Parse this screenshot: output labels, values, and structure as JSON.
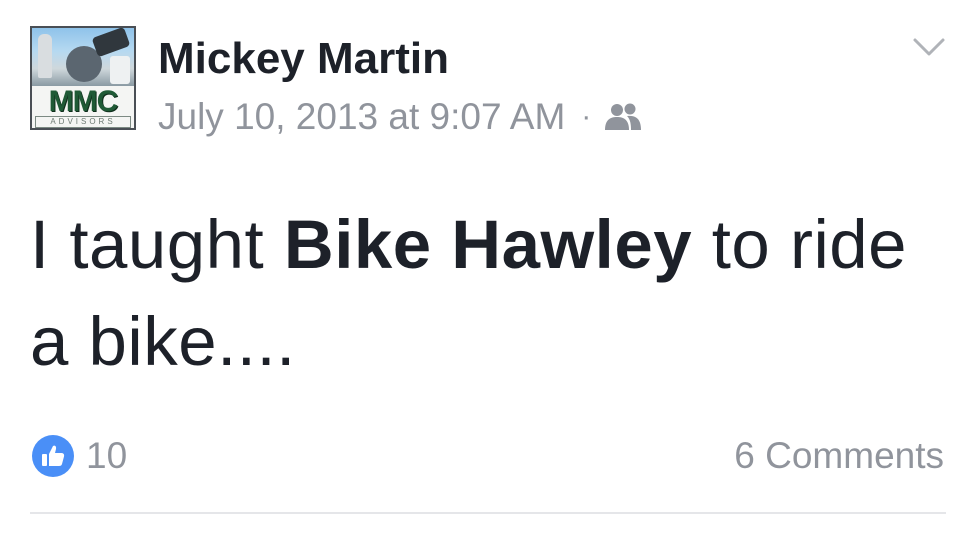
{
  "post": {
    "author": "Mickey Martin",
    "avatar": {
      "logo_text": "MMC",
      "logo_subtext": "ADVISORS",
      "icon": "profile-photo-icon"
    },
    "timestamp": "July 10, 2013 at 9:07 AM",
    "separator": "·",
    "audience_icon": "friends-icon",
    "menu_icon": "chevron-down-icon",
    "message": {
      "prefix": "I taught ",
      "mention": "Bike Hawley",
      "suffix": " to ride a bike...."
    }
  },
  "footer": {
    "like_icon": "thumbs-up-icon",
    "like_count": "10",
    "comments_label": "6 Comments"
  },
  "colors": {
    "primary_text": "#1d2129",
    "secondary_text": "#90949c",
    "like_badge": "#4a8ff7",
    "divider": "#e5e6e9"
  }
}
